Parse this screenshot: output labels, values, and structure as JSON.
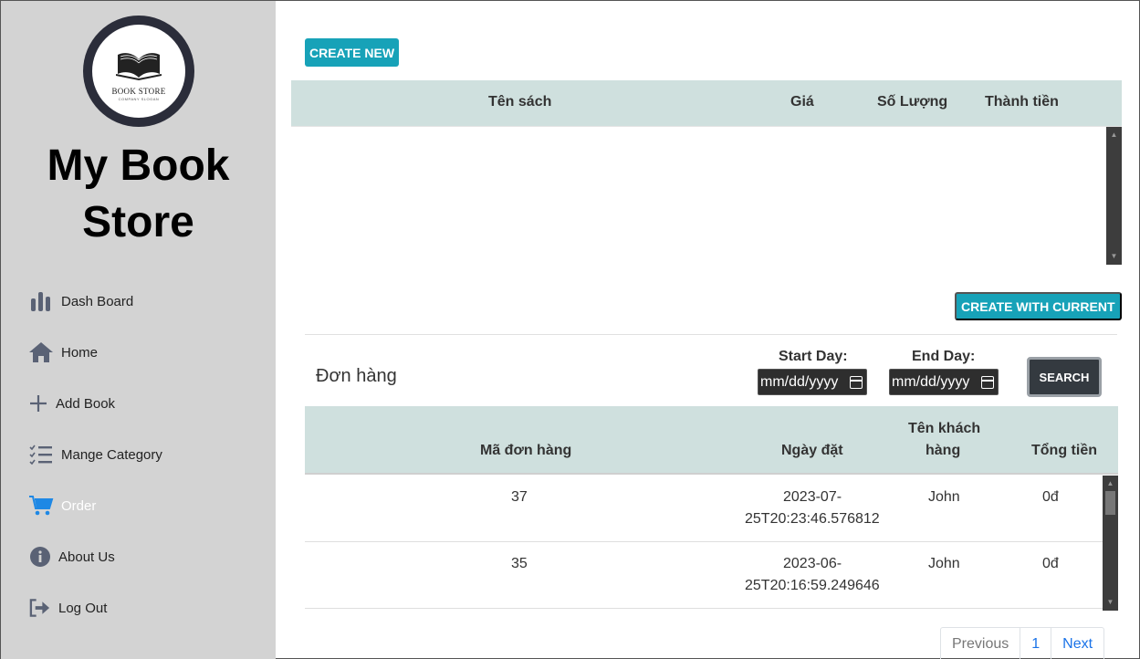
{
  "sidebar": {
    "logo_text": "BOOK STORE",
    "logo_subtext": "COMPANY SLOGAN",
    "store_name": "My Book Store",
    "items": [
      {
        "label": "Dash Board",
        "icon": "bar-chart-icon"
      },
      {
        "label": "Home",
        "icon": "home-icon"
      },
      {
        "label": "Add Book",
        "icon": "plus-icon"
      },
      {
        "label": "Mange Category",
        "icon": "checklist-icon"
      },
      {
        "label": "Order",
        "icon": "cart-icon",
        "active": true
      },
      {
        "label": "About Us",
        "icon": "info-icon"
      },
      {
        "label": "Log Out",
        "icon": "logout-icon"
      }
    ]
  },
  "cart": {
    "create_new_label": "CREATE NEW",
    "columns": [
      "Tên sách",
      "Giá",
      "Số Lượng",
      "Thành tiền"
    ],
    "create_with_current_label": "CREATE WITH CURRENT"
  },
  "orders": {
    "title": "Đơn hàng",
    "start_label": "Start Day:",
    "end_label": "End Day:",
    "start_value": "mm/dd/yyyy",
    "end_value": "mm/dd/yyyy",
    "search_label": "SEARCH",
    "columns": {
      "id": "Mã đơn hàng",
      "date": "Ngày đặt",
      "customer_line1": "Tên khách",
      "customer_line2": "hàng",
      "total": "Tổng tiền"
    },
    "rows": [
      {
        "id": "37",
        "date_line1": "2023-07-",
        "date_line2": "25T20:23:46.576812",
        "customer": "John",
        "total": "0đ"
      },
      {
        "id": "35",
        "date_line1": "2023-06-",
        "date_line2": "25T20:16:59.249646",
        "customer": "John",
        "total": "0đ"
      }
    ]
  },
  "pagination": {
    "previous": "Previous",
    "page": "1",
    "next": "Next"
  },
  "colors": {
    "sidebar_bg": "#d3d3d3",
    "accent": "#17a2b8",
    "header_bg": "#cfe0de",
    "dark_button": "#343a40",
    "link": "#1a73e8"
  }
}
